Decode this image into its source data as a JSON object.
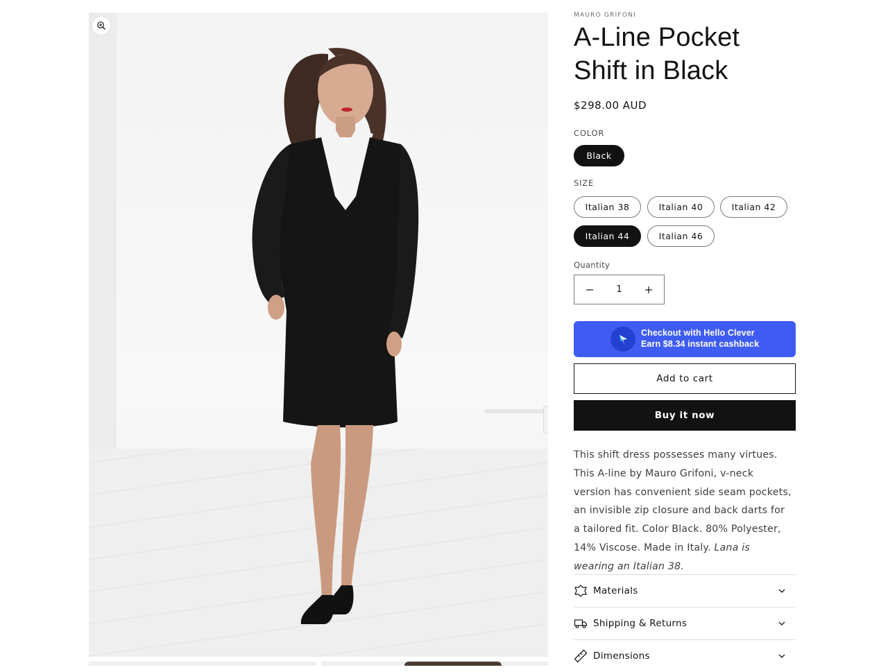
{
  "product": {
    "vendor": "MAURO GRIFONI",
    "title": "A-Line Pocket Shift in Black",
    "price": "$298.00 AUD"
  },
  "options": {
    "color": {
      "label": "COLOR",
      "values": [
        {
          "label": "Black",
          "selected": true
        }
      ]
    },
    "size": {
      "label": "SIZE",
      "values": [
        {
          "label": "Italian 38",
          "selected": false
        },
        {
          "label": "Italian 40",
          "selected": false
        },
        {
          "label": "Italian 42",
          "selected": false
        },
        {
          "label": "Italian 44",
          "selected": true
        },
        {
          "label": "Italian 46",
          "selected": false
        }
      ]
    }
  },
  "quantity": {
    "label": "Quantity",
    "value": "1",
    "decrease_icon": "minus-icon",
    "increase_icon": "plus-icon"
  },
  "checkout": {
    "hello_clever_line1": "Checkout with Hello Clever",
    "hello_clever_line2": "Earn $8.34 instant cashback",
    "hello_clever_color": "#3f5cf2",
    "add_to_cart": "Add to cart",
    "buy_now": "Buy it now"
  },
  "description": {
    "text": "This shift dress possesses many virtues. This A-line by Mauro Grifoni, v-neck version has convenient side seam pockets, an invisible zip closure and back darts for a tailored fit. Color Black. 80% Polyester, 14% Viscose. Made in Italy.",
    "note": "Lana is wearing an Italian 38."
  },
  "accordions": [
    {
      "label": "Materials",
      "icon": "fabric-icon"
    },
    {
      "label": "Shipping & Returns",
      "icon": "truck-icon"
    },
    {
      "label": "Dimensions",
      "icon": "ruler-icon"
    }
  ],
  "gallery": {
    "zoom_icon": "zoom-icon"
  }
}
